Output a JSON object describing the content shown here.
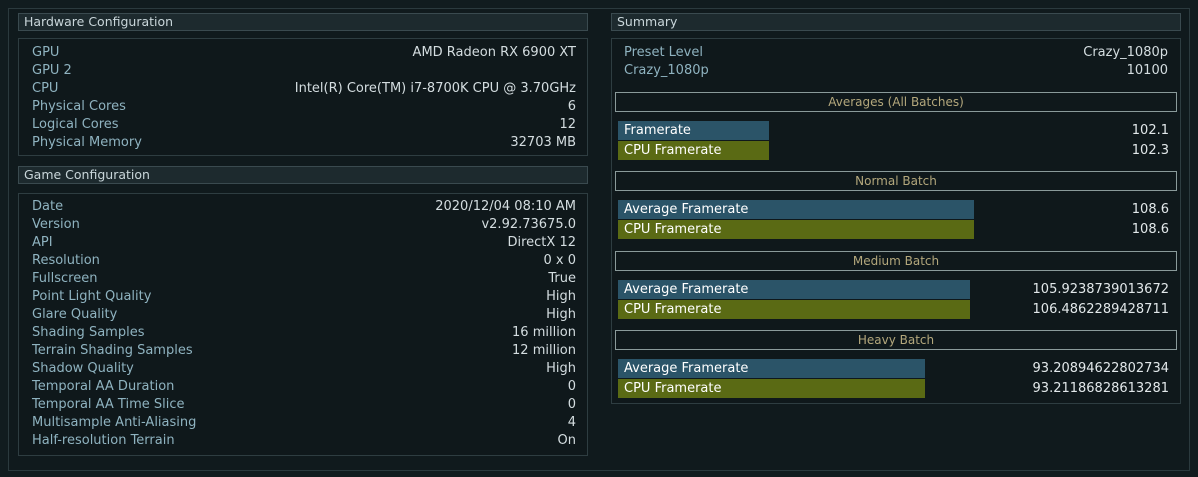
{
  "hardware": {
    "title": "Hardware Configuration",
    "rows": [
      {
        "key": "GPU",
        "value": "AMD Radeon RX 6900 XT"
      },
      {
        "key": "GPU 2",
        "value": ""
      },
      {
        "key": "CPU",
        "value": "Intel(R) Core(TM) i7-8700K CPU @ 3.70GHz"
      },
      {
        "key": "Physical Cores",
        "value": "6"
      },
      {
        "key": "Logical Cores",
        "value": "12"
      },
      {
        "key": "Physical Memory",
        "value": "32703 MB"
      }
    ]
  },
  "game": {
    "title": "Game Configuration",
    "rows": [
      {
        "key": "Date",
        "value": "2020/12/04 08:10 AM"
      },
      {
        "key": "Version",
        "value": "v2.92.73675.0"
      },
      {
        "key": "API",
        "value": "DirectX 12"
      },
      {
        "key": "Resolution",
        "value": "0 x 0"
      },
      {
        "key": "Fullscreen",
        "value": "True"
      },
      {
        "key": "Point Light Quality",
        "value": "High"
      },
      {
        "key": "Glare Quality",
        "value": "High"
      },
      {
        "key": "Shading Samples",
        "value": "16 million"
      },
      {
        "key": "Terrain Shading Samples",
        "value": "12 million"
      },
      {
        "key": "Shadow Quality",
        "value": "High"
      },
      {
        "key": "Temporal AA Duration",
        "value": "0"
      },
      {
        "key": "Temporal AA Time Slice",
        "value": "0"
      },
      {
        "key": "Multisample Anti-Aliasing",
        "value": "4"
      },
      {
        "key": "Half-resolution Terrain",
        "value": "On"
      }
    ]
  },
  "summary": {
    "title": "Summary",
    "rows": [
      {
        "key": "Preset Level",
        "value": "Crazy_1080p"
      },
      {
        "key": "Crazy_1080p",
        "value": "10100"
      }
    ],
    "batches": [
      {
        "title": "Averages (All Batches)",
        "bars": [
          {
            "label": "Framerate",
            "value": "102.1",
            "color": "#2b5468",
            "fill": 0.34
          },
          {
            "label": "CPU Framerate",
            "value": "102.3",
            "color": "#5a6a14",
            "fill": 0.34
          }
        ]
      },
      {
        "title": "Normal Batch",
        "bars": [
          {
            "label": "Average Framerate",
            "value": "108.6",
            "color": "#2b5468",
            "fill": 0.8
          },
          {
            "label": "CPU Framerate",
            "value": "108.6",
            "color": "#5a6a14",
            "fill": 0.8
          }
        ]
      },
      {
        "title": "Medium Batch",
        "bars": [
          {
            "label": "Average Framerate",
            "value": "105.9238739013672",
            "color": "#2b5468",
            "fill": 0.79
          },
          {
            "label": "CPU Framerate",
            "value": "106.4862289428711",
            "color": "#5a6a14",
            "fill": 0.79
          }
        ]
      },
      {
        "title": "Heavy Batch",
        "bars": [
          {
            "label": "Average Framerate",
            "value": "93.20894622802734",
            "color": "#2b5468",
            "fill": 0.69
          },
          {
            "label": "CPU Framerate",
            "value": "93.21186828613281",
            "color": "#5a6a14",
            "fill": 0.69
          }
        ]
      }
    ]
  }
}
